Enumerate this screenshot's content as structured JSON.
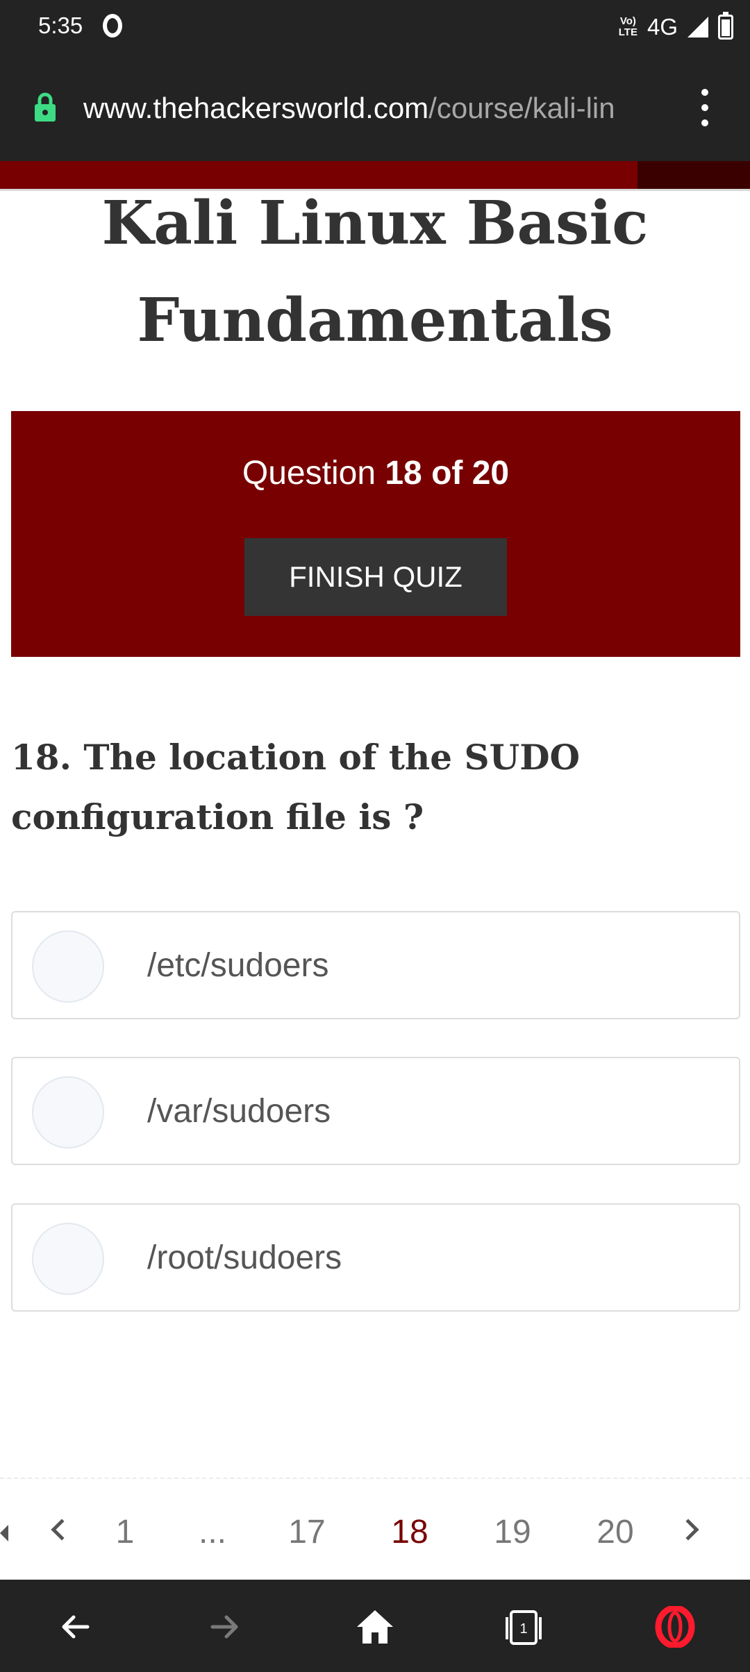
{
  "status_bar": {
    "time": "5:35",
    "volte_line1": "Vo)",
    "volte_line2": "LTE",
    "network": "4G"
  },
  "browser": {
    "url_host": "www.thehackersworld.com",
    "url_path": "/course/kali-lin"
  },
  "page": {
    "title_line1": "Kali Linux Basic",
    "title_line2": "Fundamentals"
  },
  "quiz": {
    "question_prefix": "Question ",
    "question_progress": "18 of 20",
    "finish_label": "FINISH QUIZ",
    "question_line1": "18. The location of the SUDO",
    "question_line2": "configuration file is ?",
    "options": [
      "/etc/sudoers",
      "/var/sudoers",
      "/root/sudoers"
    ]
  },
  "pagination": {
    "items": [
      "1",
      "...",
      "17",
      "18",
      "19",
      "20"
    ],
    "current": "18"
  },
  "colors": {
    "accent": "#780000",
    "chrome": "#232323",
    "button": "#343434",
    "lock": "#3ddc84",
    "opera": "#ff1b2d"
  },
  "icons": {
    "lock": "lock-icon",
    "menu": "kebab-menu-icon",
    "back": "back-arrow-icon",
    "forward": "forward-arrow-icon",
    "home": "home-icon",
    "tabs": "tabs-icon",
    "opera": "opera-logo-icon"
  }
}
